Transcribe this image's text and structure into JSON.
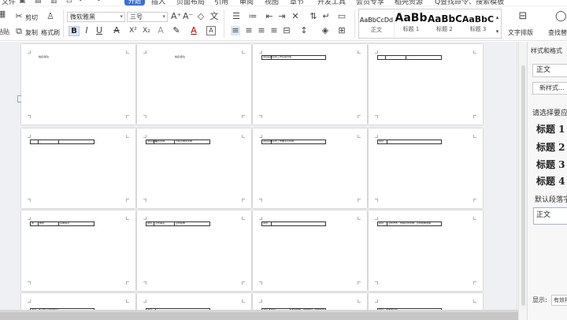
{
  "menubar": {
    "file": "文件",
    "active_tab": "开始",
    "tabs": [
      "插入",
      "页面布局",
      "引用",
      "审阅",
      "视图",
      "章节",
      "开发工具",
      "会员专享",
      "稻壳资源"
    ],
    "search": "Q查找命令、搜索模板"
  },
  "ribbon": {
    "cut": "剪切",
    "copy": "复制",
    "paste": "粘贴",
    "format_painter": "格式刷",
    "font_name": "微软雅黑",
    "font_size": "三号",
    "bold": "B",
    "italic": "I",
    "underline": "U",
    "strike": "A",
    "superscript": "X²",
    "subscript": "X₂",
    "font_color": "A",
    "char_border": "A",
    "text_layout": "文字排版",
    "find_replace": "查找替换"
  },
  "styles": [
    {
      "preview": "AaBbCcDd",
      "name": "正文"
    },
    {
      "preview": "AaBb",
      "name": "标题 1"
    },
    {
      "preview": "AaBbC",
      "name": "标题 2"
    },
    {
      "preview": "AaBbC",
      "name": "标题 3"
    }
  ],
  "pages": {
    "row1": [
      {
        "text": "姓名/职位"
      },
      {
        "text": "姓名/职位"
      },
      {
        "cells": [
          "项目名称",
          "宣传工作实施方案"
        ]
      },
      {
        "cells": [
          "",
          "",
          ""
        ]
      }
    ],
    "row2": [
      {
        "cells": [
          "",
          "",
          ""
        ]
      },
      {
        "cells": [
          "项目名称",
          "组织安排",
          "分配及统筹安排"
        ]
      },
      {
        "cells": [
          "项目名称",
          "宣传工作要点及安排"
        ]
      },
      {
        "cells": [
          "项目",
          ""
        ]
      }
    ],
    "row3": [
      {
        "cells": [
          "项",
          "概述",
          "基本情况"
        ]
      },
      {
        "cells": [
          "项目",
          "宣传渠道",
          "宣传媒体"
        ]
      },
      {
        "cells": [
          "项目",
          ""
        ]
      },
      {
        "cells": [
          "项目",
          "宣传方式、内容宣传安排、宣传媒体选择"
        ]
      }
    ],
    "row4": [
      {
        "cells": [
          "项目",
          "宣传人员配置分工"
        ]
      },
      {
        "cells": [
          "项目",
          ""
        ]
      },
      {
        "cells": [
          "项目",
          "预算",
          "费用明细、财务预算、经费使用"
        ]
      },
      {
        "cells": [
          "项目",
          "效果评估"
        ]
      }
    ]
  },
  "panel": {
    "title": "样式和格式",
    "current_style": "正文",
    "new_style": "新样式...",
    "hint": "请选择要应用的格式",
    "headings": [
      "标题 1",
      "标题 2",
      "标题 3",
      "标题 4"
    ],
    "default_font": "默认段落字体",
    "selected": "正文",
    "show_label": "显示:",
    "show_value": "有效样式"
  }
}
